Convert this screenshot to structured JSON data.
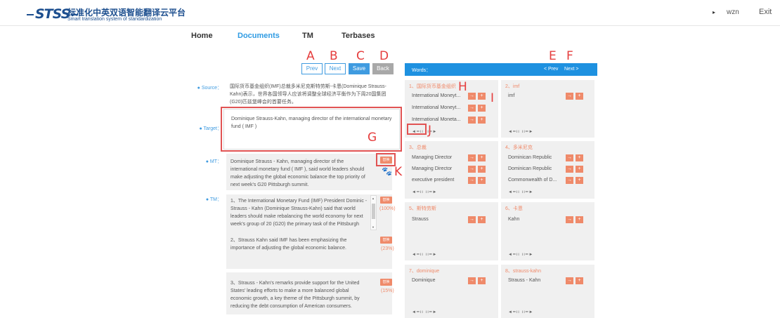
{
  "header": {
    "logo_mark": "STSS",
    "title_cn": "标准化中英双语智能翻译云平台",
    "title_en": "Smart translation system of standardization",
    "user_arrow": "▸",
    "user": "wzn",
    "exit": "Exit"
  },
  "nav": {
    "home": "Home",
    "documents": "Documents",
    "tm": "TM",
    "terbases": "Terbases"
  },
  "annot": {
    "a": "A",
    "b": "B",
    "c": "C",
    "d": "D",
    "e": "E",
    "f": "F",
    "g": "G",
    "h": "H",
    "i": "I",
    "j": "J",
    "k": "K"
  },
  "toolbar": {
    "prev": "Prev",
    "next": "Next",
    "save": "Save",
    "back": "Back"
  },
  "labels": {
    "source": "● Source：",
    "target": "● Target：",
    "mt": "● MT：",
    "tm": "● TM："
  },
  "source_text": "国际货币基金组织(IMF)总裁多米尼克斯特劳斯-卡恩(Dominique Strauss-Kahn)表示，世界各国领导人应该将调整全球经济平衡作为下周20国集团(G20)匹兹堡峰会的首要任务。",
  "target_text": "Dominique Strauss-Kahn, managing director of the international monetary fund ( IMF )",
  "mt_text": "Dominique Strauss - Kahn, managing director of the international monetary fund ( IMF ), said world leaders should make adjusting the global economic balance the top priority of next week's G20 Pittsburgh summit.",
  "replace_label": "替换",
  "paw": "🐾",
  "tm_items": [
    {
      "text": "1、The International Monetary Fund (IMF) President Dominic - Strauss - Kahn (Dominique Strauss-Kahn) said that world leaders should make rebalancing the world economy for next week's group of 20 (G20) the primary task of the Pittsburgh",
      "pct": "(100%)"
    },
    {
      "text": "2、Strauss Kahn said IMF has been emphasizing the importance of adjusting the global economic balance.",
      "pct": "(23%)"
    },
    {
      "text": "3、Strauss - Kahn's remarks provide support for the United States' leading efforts to make a more balanced global economic growth, a key theme of the Pittsburgh summit, by reducing the debt consumption of American consumers.",
      "pct": "(15%)"
    }
  ],
  "scroll": {
    "up": "▲",
    "down": "▼"
  },
  "words": {
    "label": "Words：",
    "prev": "< Prev",
    "next": "Next >",
    "btn_arrow": "→",
    "btn_plus": "+",
    "nav_arrows": "◄━ıı   ıı━►",
    "cards": [
      {
        "head": "1、国际货币基金组织",
        "rows": [
          "International Moneyt...",
          "International Moneyt...",
          "International Moneta..."
        ]
      },
      {
        "head": "2、imf",
        "rows": [
          "imf"
        ]
      },
      {
        "head": "3、总裁",
        "rows": [
          "Managing Director",
          "Managing Director",
          "executive president"
        ]
      },
      {
        "head": "4、多米尼克",
        "rows": [
          "Dominican Republic",
          "Dominican Republic",
          "Commonwealth of D..."
        ]
      },
      {
        "head": "5、斯特劳斯",
        "rows": [
          "Strauss"
        ]
      },
      {
        "head": "6、卡恩",
        "rows": [
          "Kahn"
        ]
      },
      {
        "head": "7、dominique",
        "rows": [
          "Dominique"
        ]
      },
      {
        "head": "8、strauss-kahn",
        "rows": [
          "Strauss - Kahn"
        ]
      }
    ]
  }
}
